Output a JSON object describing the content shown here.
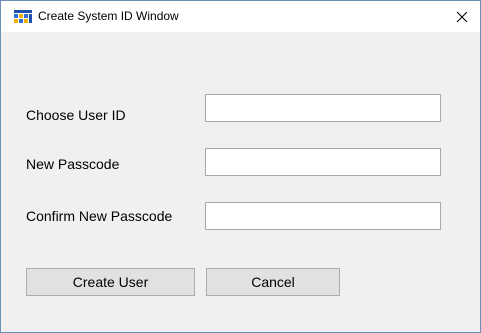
{
  "window": {
    "title": "Create System ID Window"
  },
  "form": {
    "user_id_label": "Choose User ID",
    "user_id_value": "",
    "passcode_label": "New Passcode",
    "passcode_value": "",
    "confirm_label": "Confirm New Passcode",
    "confirm_value": ""
  },
  "buttons": {
    "create_label": "Create User",
    "cancel_label": "Cancel"
  },
  "icons": {
    "app": "app-icon",
    "close": "close-icon"
  }
}
